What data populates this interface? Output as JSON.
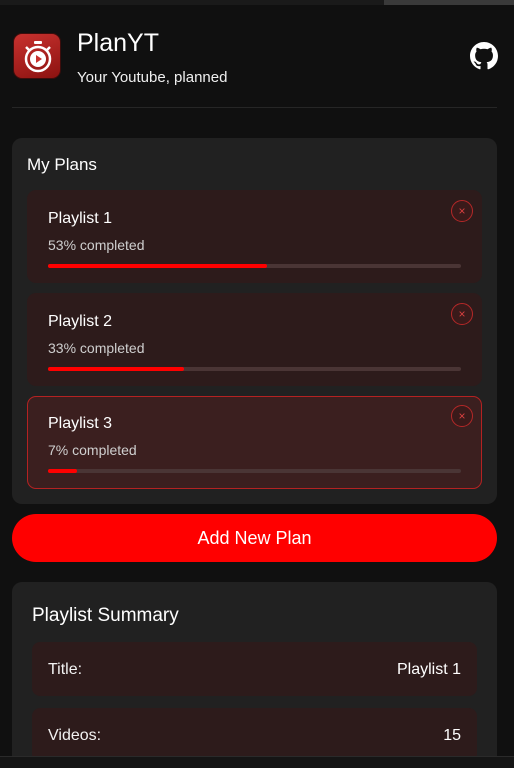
{
  "app": {
    "title": "PlanYT",
    "subtitle": "Your Youtube, planned",
    "logo_icon": "stopwatch-play-icon",
    "github_icon": "github-icon"
  },
  "plans": {
    "title": "My Plans",
    "items": [
      {
        "name": "Playlist 1",
        "progress_text": "53% completed",
        "progress": 0.53,
        "selected": false
      },
      {
        "name": "Playlist 2",
        "progress_text": "33% completed",
        "progress": 0.33,
        "selected": false
      },
      {
        "name": "Playlist 3",
        "progress_text": "7% completed",
        "progress": 0.07,
        "selected": true
      }
    ],
    "delete_glyph": "×"
  },
  "add_button": {
    "label": "Add New Plan"
  },
  "summary": {
    "title": "Playlist Summary",
    "rows": [
      {
        "label": "Title:",
        "value": "Playlist 1"
      },
      {
        "label": "Videos:",
        "value": "15"
      }
    ]
  },
  "colors": {
    "accent": "#ff0000",
    "background": "#101010",
    "card": "#212121",
    "plan_bg": "#2d1b1b"
  }
}
